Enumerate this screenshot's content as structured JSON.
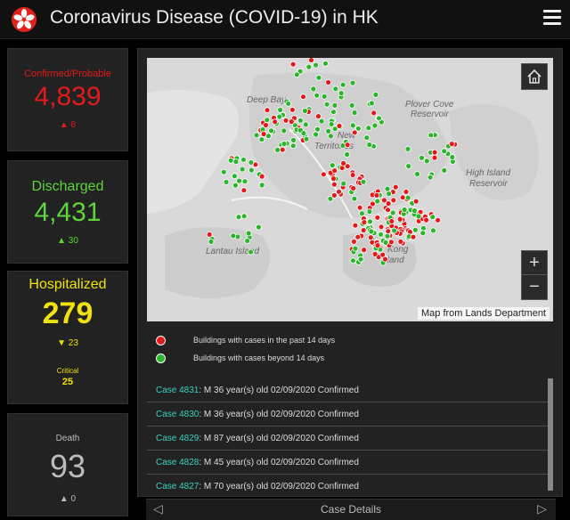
{
  "header": {
    "title": "Coronavirus Disease (COVID-19) in HK",
    "logo_icon": "bauhinia-flower-icon",
    "menu_icon": "hamburger-menu-icon"
  },
  "stats": {
    "confirmed": {
      "label": "Confirmed/Probable",
      "value": "4,839",
      "delta": "▲ 8",
      "color": "#e31a1c"
    },
    "discharged": {
      "label": "Discharged",
      "value": "4,431",
      "delta": "▲ 30",
      "color": "#5cd63a"
    },
    "hospitalized": {
      "label": "Hospitalized",
      "value": "279",
      "delta": "▼ 23",
      "critical_label": "Critical",
      "critical_value": "25",
      "color": "#f0e20c"
    },
    "death": {
      "label": "Death",
      "value": "93",
      "delta": "▲ 0"
    }
  },
  "map": {
    "labels": [
      "Deep Bay",
      "Plover Cove",
      "Reservoir",
      "New",
      "Territories",
      "High Island",
      "Reservoir",
      "Lantau Island",
      "Kong",
      "Island"
    ],
    "attribution": "Map from Lands Department",
    "zoom_in": "+",
    "zoom_out": "−",
    "home_icon": "home-icon"
  },
  "legend": [
    {
      "label": "Buildings with cases in the past 14 days",
      "color": "#e31a1c"
    },
    {
      "label": "Buildings with cases beyond 14 days",
      "color": "#2bb52b"
    }
  ],
  "cases": [
    {
      "id": "Case 4831",
      "info": ": M  36 year(s) old  02/09/2020 Confirmed"
    },
    {
      "id": "Case 4830",
      "info": ": M  36 year(s) old  02/09/2020 Confirmed"
    },
    {
      "id": "Case 4829",
      "info": ": M  87 year(s) old  02/09/2020 Confirmed"
    },
    {
      "id": "Case 4828",
      "info": ": M  45 year(s) old  02/09/2020 Confirmed"
    },
    {
      "id": "Case 4827",
      "info": ": M  70 year(s) old  02/09/2020 Confirmed"
    }
  ],
  "bottom_bar": {
    "title": "Case Details",
    "prev": "◁",
    "next": "▷"
  }
}
